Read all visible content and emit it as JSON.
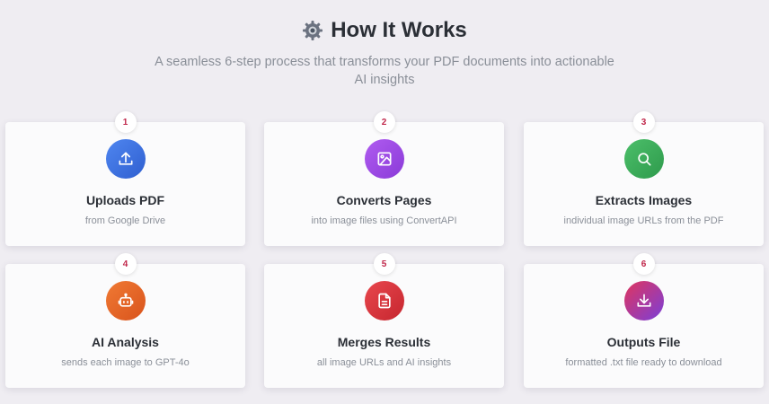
{
  "header": {
    "title": "How It Works",
    "title_icon": "gear-icon",
    "subtitle": "A seamless 6-step process that transforms your PDF documents into actionable AI insights"
  },
  "steps": [
    {
      "number": "1",
      "title": "Uploads PDF",
      "description": "from Google Drive",
      "icon": "upload-icon",
      "color": "#3b6fe0"
    },
    {
      "number": "2",
      "title": "Converts Pages",
      "description": "into image files using ConvertAPI",
      "icon": "image-icon",
      "color": "#9b4ce6"
    },
    {
      "number": "3",
      "title": "Extracts Images",
      "description": "individual image URLs from the PDF",
      "icon": "search-icon",
      "color": "#37a957"
    },
    {
      "number": "4",
      "title": "AI Analysis",
      "description": "sends each image to GPT-4o",
      "icon": "robot-icon",
      "color": "#e8662a"
    },
    {
      "number": "5",
      "title": "Merges Results",
      "description": "all image URLs and AI insights",
      "icon": "document-icon",
      "color": "#d9323b"
    },
    {
      "number": "6",
      "title": "Outputs File",
      "description": "formatted .txt file ready to download",
      "icon": "download-icon",
      "color": "#c92f68"
    }
  ]
}
